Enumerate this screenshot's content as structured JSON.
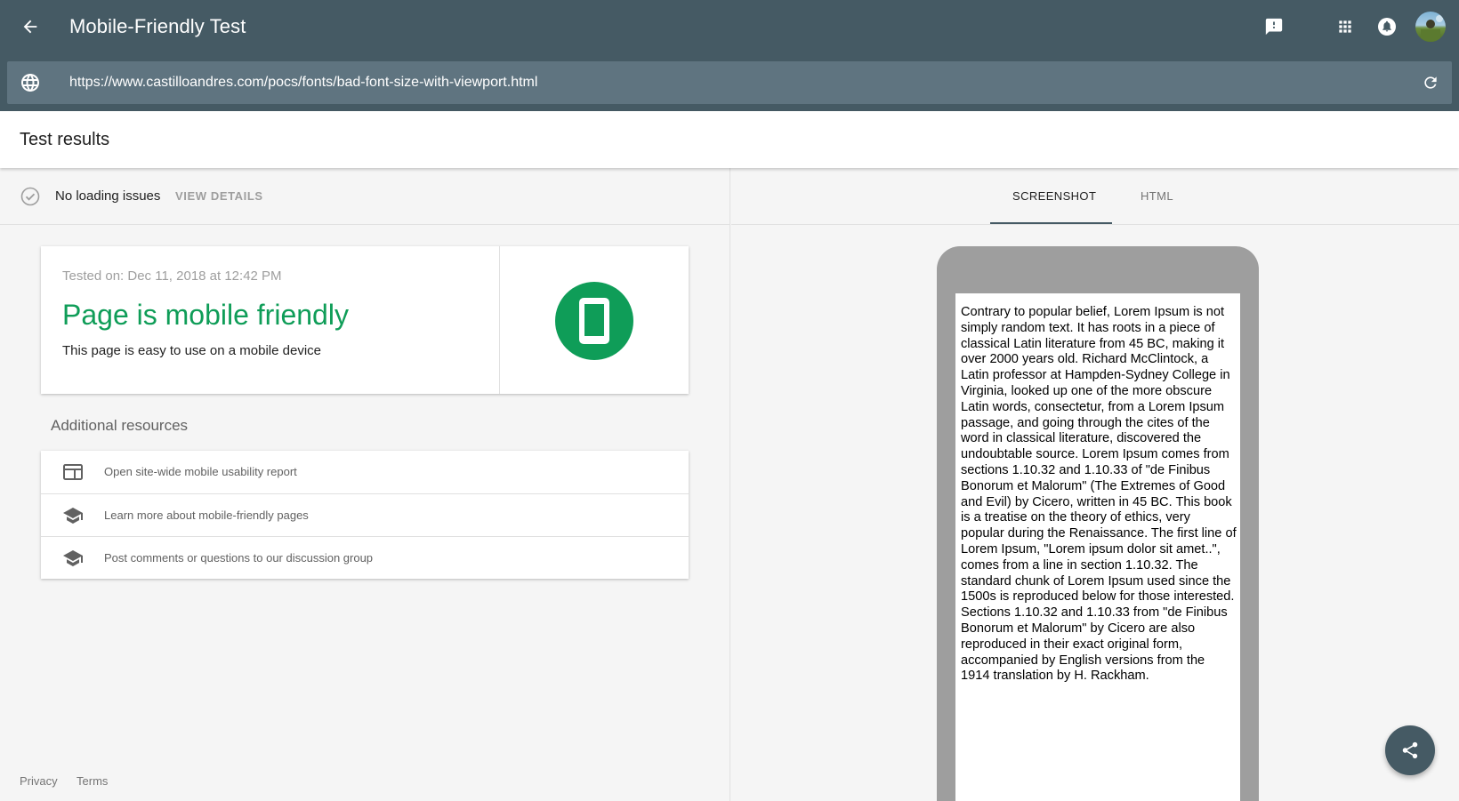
{
  "app": {
    "title": "Mobile-Friendly Test",
    "url": "https://www.castilloandres.com/pocs/fonts/bad-font-size-with-viewport.html",
    "icons": {
      "back": "arrow-back-icon",
      "feedback": "feedback-icon",
      "apps": "apps-grid-icon",
      "notifications": "notifications-icon",
      "globe": "globe-icon",
      "reload": "reload-icon"
    }
  },
  "results": {
    "title": "Test results",
    "status_text": "No loading issues",
    "view_details": "VIEW DETAILS",
    "tested_on": "Tested on: Dec 11, 2018 at 12:42 PM",
    "verdict": "Page is mobile friendly",
    "verdict_sub": "This page is easy to use on a mobile device",
    "verdict_color": "#0f9d58"
  },
  "resources": {
    "title": "Additional resources",
    "items": [
      {
        "label": "Open site-wide mobile usability report",
        "icon": "web-report-icon"
      },
      {
        "label": "Learn more about mobile-friendly pages",
        "icon": "school-icon"
      },
      {
        "label": "Post comments or questions to our discussion group",
        "icon": "school-icon"
      }
    ]
  },
  "footer": {
    "privacy": "Privacy",
    "terms": "Terms"
  },
  "preview": {
    "tabs": [
      {
        "label": "SCREENSHOT",
        "active": true
      },
      {
        "label": "HTML",
        "active": false
      }
    ],
    "page_text": "Contrary to popular belief, Lorem Ipsum is not simply random text. It has roots in a piece of classical Latin literature from 45 BC, making it over 2000 years old. Richard McClintock, a Latin professor at Hampden-Sydney College in Virginia, looked up one of the more obscure Latin words, consectetur, from a Lorem Ipsum passage, and going through the cites of the word in classical literature, discovered the undoubtable source. Lorem Ipsum comes from sections 1.10.32 and 1.10.33 of \"de Finibus Bonorum et Malorum\" (The Extremes of Good and Evil) by Cicero, written in 45 BC. This book is a treatise on the theory of ethics, very popular during the Renaissance. The first line of Lorem Ipsum, \"Lorem ipsum dolor sit amet..\", comes from a line in section 1.10.32. The standard chunk of Lorem Ipsum used since the 1500s is reproduced below for those interested. Sections 1.10.32 and 1.10.33 from \"de Finibus Bonorum et Malorum\" by Cicero are also reproduced in their exact original form, accompanied by English versions from the 1914 translation by H. Rackham."
  },
  "theme": {
    "primary": "#455a64",
    "url_bar": "#5f7480",
    "success": "#0f9d58"
  }
}
